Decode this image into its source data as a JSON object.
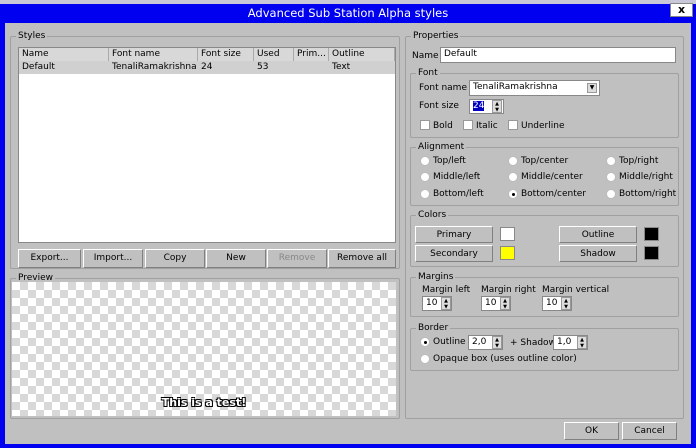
{
  "window": {
    "title": "Advanced Sub Station Alpha styles",
    "close_label": "x"
  },
  "styles": {
    "legend": "Styles",
    "columns": [
      "Name",
      "Font name",
      "Font size",
      "Used",
      "Prim...",
      "Outline"
    ],
    "rows": [
      [
        "Default",
        "TenaliRamakrishna",
        "24",
        "53",
        "",
        "Text"
      ]
    ],
    "buttons": {
      "export": "Export...",
      "import": "Import...",
      "copy": "Copy",
      "new": "New",
      "remove": "Remove",
      "remove_all": "Remove all"
    }
  },
  "preview": {
    "legend": "Preview",
    "text": "This is a test!"
  },
  "properties": {
    "legend": "Properties",
    "name_label": "Name",
    "name_value": "Default",
    "font": {
      "legend": "Font",
      "name_label": "Font name",
      "name_value": "TenaliRamakrishna",
      "size_label": "Font size",
      "size_value": "24",
      "bold": "Bold",
      "italic": "Italic",
      "underline": "Underline"
    },
    "alignment": {
      "legend": "Alignment",
      "options": [
        "Top/left",
        "Top/center",
        "Top/right",
        "Middle/left",
        "Middle/center",
        "Middle/right",
        "Bottom/left",
        "Bottom/center",
        "Bottom/right"
      ],
      "selected": "Bottom/center"
    },
    "colors": {
      "legend": "Colors",
      "primary": "Primary",
      "secondary": "Secondary",
      "outline": "Outline",
      "shadow": "Shadow",
      "primary_color": "#ffffff",
      "secondary_color": "#ffff00",
      "outline_color": "#000000",
      "shadow_color": "#000000"
    },
    "margins": {
      "legend": "Margins",
      "left_label": "Margin left",
      "right_label": "Margin right",
      "vertical_label": "Margin vertical",
      "left": "10",
      "right": "10",
      "vertical": "10"
    },
    "border": {
      "legend": "Border",
      "outline_label": "Outline",
      "outline_value": "2,0",
      "shadow_label": "+ Shadow",
      "shadow_value": "1,0",
      "opaque_label": "Opaque box (uses outline color)"
    }
  },
  "footer": {
    "ok": "OK",
    "cancel": "Cancel"
  }
}
